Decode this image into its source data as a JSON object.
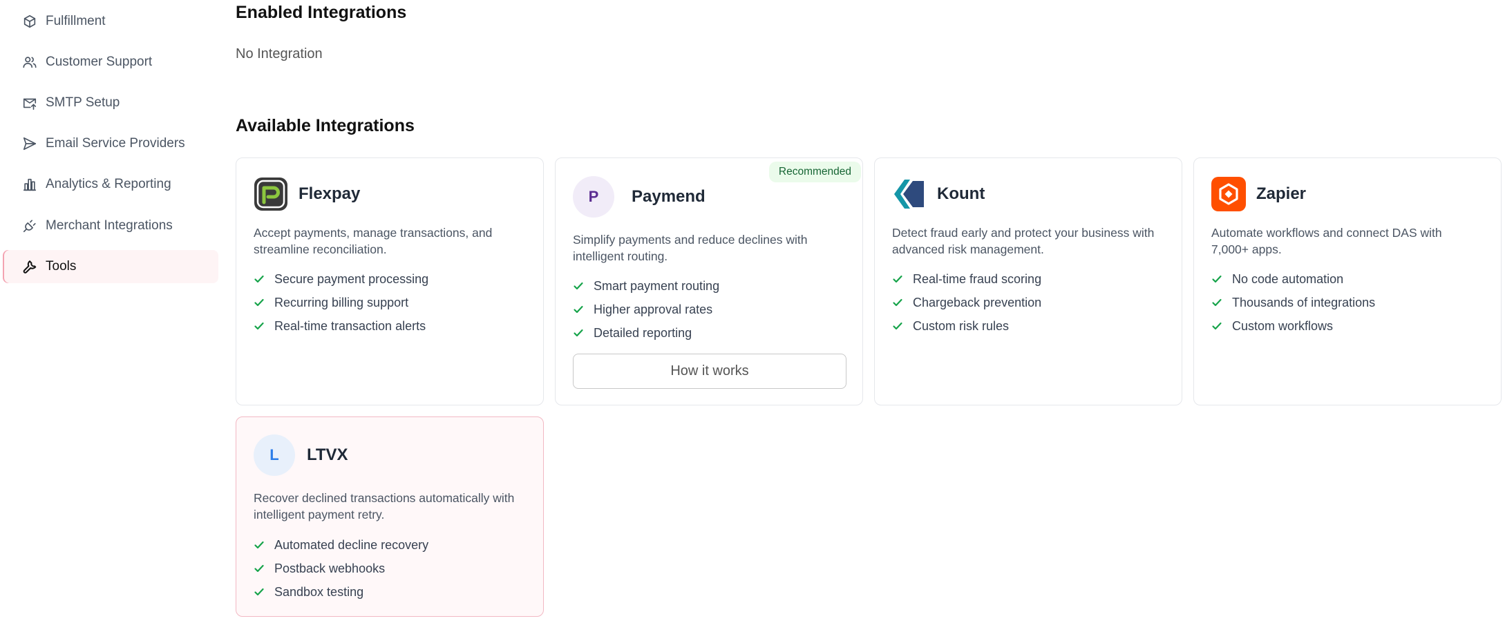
{
  "sidebar": {
    "items": [
      {
        "label": "Fulfillment",
        "icon": "package-icon"
      },
      {
        "label": "Customer Support",
        "icon": "users-icon"
      },
      {
        "label": "SMTP Setup",
        "icon": "mail-upload-icon"
      },
      {
        "label": "Email Service Providers",
        "icon": "send-icon"
      },
      {
        "label": "Analytics & Reporting",
        "icon": "bar-chart-icon"
      },
      {
        "label": "Merchant Integrations",
        "icon": "plug-icon"
      },
      {
        "label": "Tools",
        "icon": "wrench-icon",
        "active": true
      }
    ]
  },
  "main": {
    "enabled_title": "Enabled Integrations",
    "enabled_empty": "No Integration",
    "available_title": "Available Integrations",
    "cards": [
      {
        "name": "Flexpay",
        "description": "Accept payments, manage transactions, and streamline reconciliation.",
        "features": [
          "Secure payment processing",
          "Recurring billing support",
          "Real-time transaction alerts"
        ]
      },
      {
        "name": "Paymend",
        "logo_letter": "P",
        "badge": "Recommended",
        "description": "Simplify payments and reduce declines with intelligent routing.",
        "features": [
          "Smart payment routing",
          "Higher approval rates",
          "Detailed reporting"
        ],
        "button": "How it works"
      },
      {
        "name": "Kount",
        "description": "Detect fraud early and protect your business with advanced risk management.",
        "features": [
          "Real-time fraud scoring",
          "Chargeback prevention",
          "Custom risk rules"
        ]
      },
      {
        "name": "Zapier",
        "description": "Automate workflows and connect DAS with 7,000+ apps.",
        "features": [
          "No code automation",
          "Thousands of integrations",
          "Custom workflows"
        ]
      },
      {
        "name": "LTVX",
        "logo_letter": "L",
        "description": "Recover declined transactions automatically with intelligent payment retry.",
        "features": [
          "Automated decline recovery",
          "Postback webhooks",
          "Sandbox testing"
        ]
      }
    ]
  },
  "colors": {
    "check": "#16a34a",
    "active_nav_bg": "#fef4f5",
    "badge_bg": "#ebfbeb",
    "zapier": "#ff4f00",
    "kount_dark": "#2e4a7d",
    "kount_teal": "#1496a8",
    "flexpay_green": "#8cc63f",
    "paymend_purple": "#5b2d91",
    "ltvx_blue": "#2b7de9"
  }
}
